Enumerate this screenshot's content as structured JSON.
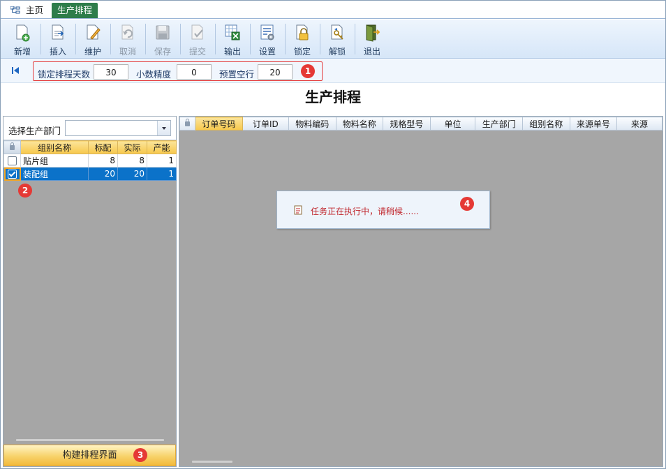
{
  "tabs": {
    "home": "主页",
    "active": "生产排程"
  },
  "toolbar": {
    "items": [
      {
        "label": "新增",
        "icon": "new-doc-icon",
        "enabled": true
      },
      {
        "label": "插入",
        "icon": "insert-icon",
        "enabled": true
      },
      {
        "label": "维护",
        "icon": "edit-icon",
        "enabled": true
      },
      {
        "label": "取消",
        "icon": "undo-icon",
        "enabled": false
      },
      {
        "label": "保存",
        "icon": "save-icon",
        "enabled": false
      },
      {
        "label": "提交",
        "icon": "submit-icon",
        "enabled": false
      },
      {
        "label": "输出",
        "icon": "export-icon",
        "enabled": true
      },
      {
        "label": "设置",
        "icon": "settings-icon",
        "enabled": true
      },
      {
        "label": "锁定",
        "icon": "lock-icon",
        "enabled": true
      },
      {
        "label": "解锁",
        "icon": "unlock-icon",
        "enabled": true
      },
      {
        "label": "退出",
        "icon": "exit-icon",
        "enabled": true
      }
    ]
  },
  "params": {
    "lock_days_label": "锁定排程天数",
    "lock_days_value": "30",
    "decimal_label": "小数精度",
    "decimal_value": "0",
    "reserve_label": "预置空行",
    "reserve_value": "20"
  },
  "markers": [
    "1",
    "2",
    "3",
    "4"
  ],
  "title": "生产排程",
  "left": {
    "dept_label": "选择生产部门",
    "dept_value": "",
    "columns": [
      "组别名称",
      "标配",
      "实际",
      "产能"
    ],
    "rows": [
      {
        "checked": false,
        "name": "贴片组",
        "std": "8",
        "actual": "8",
        "cap": "1"
      },
      {
        "checked": true,
        "name": "装配组",
        "std": "20",
        "actual": "20",
        "cap": "1"
      }
    ],
    "build_button": "构建排程界面"
  },
  "right": {
    "columns": [
      "订单号码",
      "订单ID",
      "物料编码",
      "物料名称",
      "规格型号",
      "单位",
      "生产部门",
      "组别名称",
      "来源单号",
      "来源"
    ]
  },
  "dialog": {
    "message": "任务正在执行中，请稍候......"
  },
  "colors": {
    "accent_green": "#2e7d4a",
    "selection_blue": "#0b72c9",
    "marker_red": "#e53935",
    "header_gold": "#f7c84b"
  }
}
